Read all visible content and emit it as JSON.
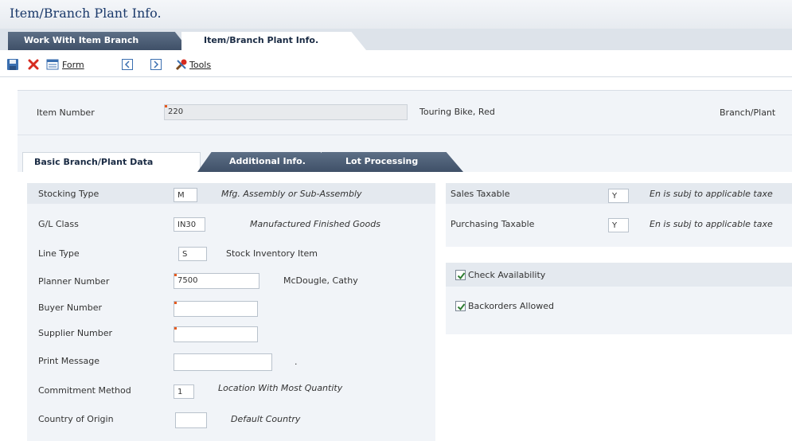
{
  "window": {
    "title": "Item/Branch Plant Info."
  },
  "page_tabs": [
    {
      "label": "Work With Item Branch"
    },
    {
      "label": "Item/Branch Plant Info."
    }
  ],
  "toolbar": {
    "form_label": "Form",
    "tools_label": "Tools",
    "icons": [
      "save-icon",
      "delete-icon",
      "form-icon",
      "previous-icon",
      "next-icon",
      "tools-icon"
    ]
  },
  "header": {
    "item_number_label": "Item Number",
    "item_number_value": "220",
    "item_description": "Touring Bike, Red",
    "branch_plant_label": "Branch/Plant"
  },
  "sub_tabs": [
    {
      "label": "Basic Branch/Plant Data"
    },
    {
      "label": "Additional Info."
    },
    {
      "label": "Lot Processing"
    }
  ],
  "left_fields": {
    "stocking_type": {
      "label": "Stocking Type",
      "value": "M",
      "desc": "Mfg. Assembly or Sub-Assembly"
    },
    "gl_class": {
      "label": "G/L Class",
      "value": "IN30",
      "desc": "Manufactured Finished Goods"
    },
    "line_type": {
      "label": "Line Type",
      "value": "S",
      "desc": "Stock Inventory Item"
    },
    "planner_number": {
      "label": "Planner Number",
      "value": "7500",
      "desc": "McDougle, Cathy"
    },
    "buyer_number": {
      "label": "Buyer Number",
      "value": ""
    },
    "supplier_number": {
      "label": "Supplier Number",
      "value": ""
    },
    "print_message": {
      "label": "Print Message",
      "value": "",
      "desc": "."
    },
    "commitment_method": {
      "label": "Commitment Method",
      "value": "1",
      "desc": "Location With Most Quantity"
    },
    "country_of_origin": {
      "label": "Country of Origin",
      "value": "",
      "desc": "Default Country"
    }
  },
  "right_fields": {
    "sales_taxable": {
      "label": "Sales Taxable",
      "value": "Y",
      "desc": "En is subj to applicable taxe"
    },
    "purchasing_taxable": {
      "label": "Purchasing Taxable",
      "value": "Y",
      "desc": "En is subj to applicable taxe"
    },
    "check_availability": {
      "label": "Check Availability",
      "checked": true
    },
    "backorders_allowed": {
      "label": "Backorders Allowed",
      "checked": true
    }
  },
  "colors": {
    "required_marker": "#e55a1f",
    "tab_dark": "#4a5b72",
    "title": "#1b3a6b"
  }
}
